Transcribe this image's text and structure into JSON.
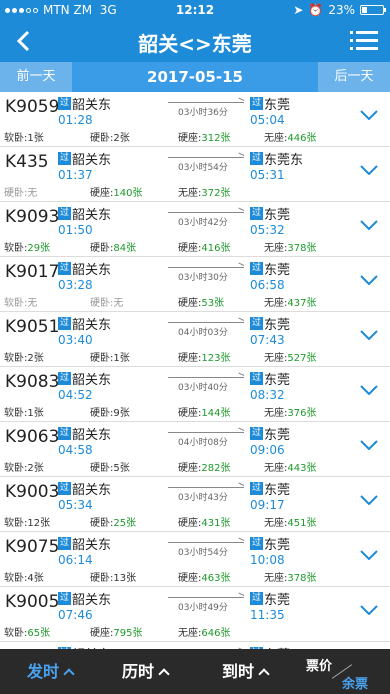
{
  "status_bar": {
    "carrier": "MTN ZM",
    "network": "3G",
    "time": "12:12",
    "battery": "23%",
    "battery_level": 0.23
  },
  "header": {
    "title": "韶关<>东莞"
  },
  "date_bar": {
    "prev_label": "前一天",
    "date": "2017-05-15",
    "next_label": "后一天"
  },
  "trains": [
    {
      "no": "K9059",
      "tag": "过",
      "from": "韶关东",
      "dep": "01:28",
      "duration": "03小时36分",
      "to_tag": "过",
      "to": "东莞",
      "arr": "05:04",
      "seats": [
        {
          "label": "软卧:",
          "value": "1张"
        },
        {
          "label": "硬卧:",
          "value": "2张"
        },
        {
          "label": "硬座:",
          "value": "312张",
          "green": true
        },
        {
          "label": "无座:",
          "value": "446张",
          "green": true
        }
      ]
    },
    {
      "no": "K435",
      "tag": "过",
      "from": "韶关东",
      "dep": "01:37",
      "duration": "03小时54分",
      "to_tag": "过",
      "to": "东莞东",
      "arr": "05:31",
      "seats": [
        {
          "label": "硬卧:",
          "value": "无",
          "gray": true
        },
        {
          "label": "硬座:",
          "value": "140张",
          "green": true
        },
        {
          "label": "无座:",
          "value": "372张",
          "green": true
        },
        {
          "label": "",
          "value": ""
        }
      ]
    },
    {
      "no": "K9093",
      "tag": "过",
      "from": "韶关东",
      "dep": "01:50",
      "duration": "03小时42分",
      "to_tag": "过",
      "to": "东莞",
      "arr": "05:32",
      "seats": [
        {
          "label": "软卧:",
          "value": "29张",
          "green": true
        },
        {
          "label": "硬卧:",
          "value": "84张",
          "green": true
        },
        {
          "label": "硬座:",
          "value": "416张",
          "green": true
        },
        {
          "label": "无座:",
          "value": "378张",
          "green": true
        }
      ]
    },
    {
      "no": "K9017",
      "tag": "过",
      "from": "韶关东",
      "dep": "03:28",
      "duration": "03小时30分",
      "to_tag": "过",
      "to": "东莞",
      "arr": "06:58",
      "seats": [
        {
          "label": "软卧:",
          "value": "无",
          "gray": true
        },
        {
          "label": "硬卧:",
          "value": "无",
          "gray": true
        },
        {
          "label": "硬座:",
          "value": "53张",
          "green": true
        },
        {
          "label": "无座:",
          "value": "437张",
          "green": true
        }
      ]
    },
    {
      "no": "K9051",
      "tag": "过",
      "from": "韶关东",
      "dep": "03:40",
      "duration": "04小时03分",
      "to_tag": "过",
      "to": "东莞",
      "arr": "07:43",
      "seats": [
        {
          "label": "软卧:",
          "value": "2张"
        },
        {
          "label": "硬卧:",
          "value": "1张"
        },
        {
          "label": "硬座:",
          "value": "123张",
          "green": true
        },
        {
          "label": "无座:",
          "value": "527张",
          "green": true
        }
      ]
    },
    {
      "no": "K9083",
      "tag": "过",
      "from": "韶关东",
      "dep": "04:52",
      "duration": "03小时40分",
      "to_tag": "过",
      "to": "东莞",
      "arr": "08:32",
      "seats": [
        {
          "label": "软卧:",
          "value": "1张"
        },
        {
          "label": "硬卧:",
          "value": "9张"
        },
        {
          "label": "硬座:",
          "value": "144张",
          "green": true
        },
        {
          "label": "无座:",
          "value": "376张",
          "green": true
        }
      ]
    },
    {
      "no": "K9063",
      "tag": "过",
      "from": "韶关东",
      "dep": "04:58",
      "duration": "04小时08分",
      "to_tag": "过",
      "to": "东莞",
      "arr": "09:06",
      "seats": [
        {
          "label": "软卧:",
          "value": "2张"
        },
        {
          "label": "硬卧:",
          "value": "5张"
        },
        {
          "label": "硬座:",
          "value": "282张",
          "green": true
        },
        {
          "label": "无座:",
          "value": "443张",
          "green": true
        }
      ]
    },
    {
      "no": "K9003",
      "tag": "过",
      "from": "韶关东",
      "dep": "05:34",
      "duration": "03小时43分",
      "to_tag": "过",
      "to": "东莞",
      "arr": "09:17",
      "seats": [
        {
          "label": "软卧:",
          "value": "12张"
        },
        {
          "label": "硬卧:",
          "value": "25张",
          "green": true
        },
        {
          "label": "硬座:",
          "value": "431张",
          "green": true
        },
        {
          "label": "无座:",
          "value": "451张",
          "green": true
        }
      ]
    },
    {
      "no": "K9075",
      "tag": "过",
      "from": "韶关东",
      "dep": "06:14",
      "duration": "03小时54分",
      "to_tag": "过",
      "to": "东莞",
      "arr": "10:08",
      "seats": [
        {
          "label": "软卧:",
          "value": "4张"
        },
        {
          "label": "硬卧:",
          "value": "13张"
        },
        {
          "label": "硬座:",
          "value": "463张",
          "green": true
        },
        {
          "label": "无座:",
          "value": "378张",
          "green": true
        }
      ]
    },
    {
      "no": "K9005",
      "tag": "过",
      "from": "韶关东",
      "dep": "07:46",
      "duration": "03小时49分",
      "to_tag": "过",
      "to": "东莞",
      "arr": "11:35",
      "seats": [
        {
          "label": "软卧:",
          "value": "65张",
          "green": true
        },
        {
          "label": "硬座:",
          "value": "795张",
          "green": true
        },
        {
          "label": "无座:",
          "value": "646张",
          "green": true
        },
        {
          "label": "",
          "value": ""
        }
      ]
    },
    {
      "no": "",
      "tag": "过",
      "from": "韶关东",
      "dep": "",
      "duration": "",
      "to_tag": "过",
      "to": "东莞",
      "arr": "",
      "seats": [
        {
          "label": "",
          "value": ""
        },
        {
          "label": "",
          "value": ""
        },
        {
          "label": "",
          "value": ""
        },
        {
          "label": "",
          "value": ""
        }
      ]
    }
  ],
  "bottom_bar": {
    "depart": "发时",
    "duration": "历时",
    "arrive": "到时",
    "price": "票价",
    "remaining": "余票"
  },
  "colors": {
    "primary": "#1e8bd9",
    "green": "#1d9a2a",
    "dark": "#2a2a2a"
  }
}
